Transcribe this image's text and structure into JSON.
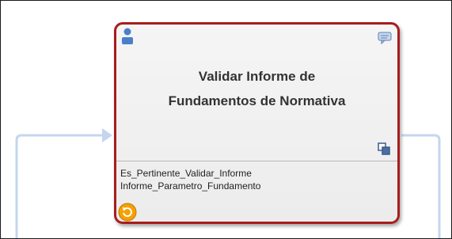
{
  "diagram": {
    "task": {
      "title_line1": "Validar Informe de",
      "title_line2": "Fundamentos de Normativa",
      "variables": [
        "Es_Pertinente_Validar_Informe",
        "Informe_Parametro_Fundamento"
      ],
      "border_color": "#a81d1d",
      "icons": {
        "user": "user-icon",
        "comment": "comment-icon",
        "multi_instance": "multi-instance-icon",
        "loop": "loop-icon"
      }
    },
    "connector_color": "#c5d5f0"
  }
}
